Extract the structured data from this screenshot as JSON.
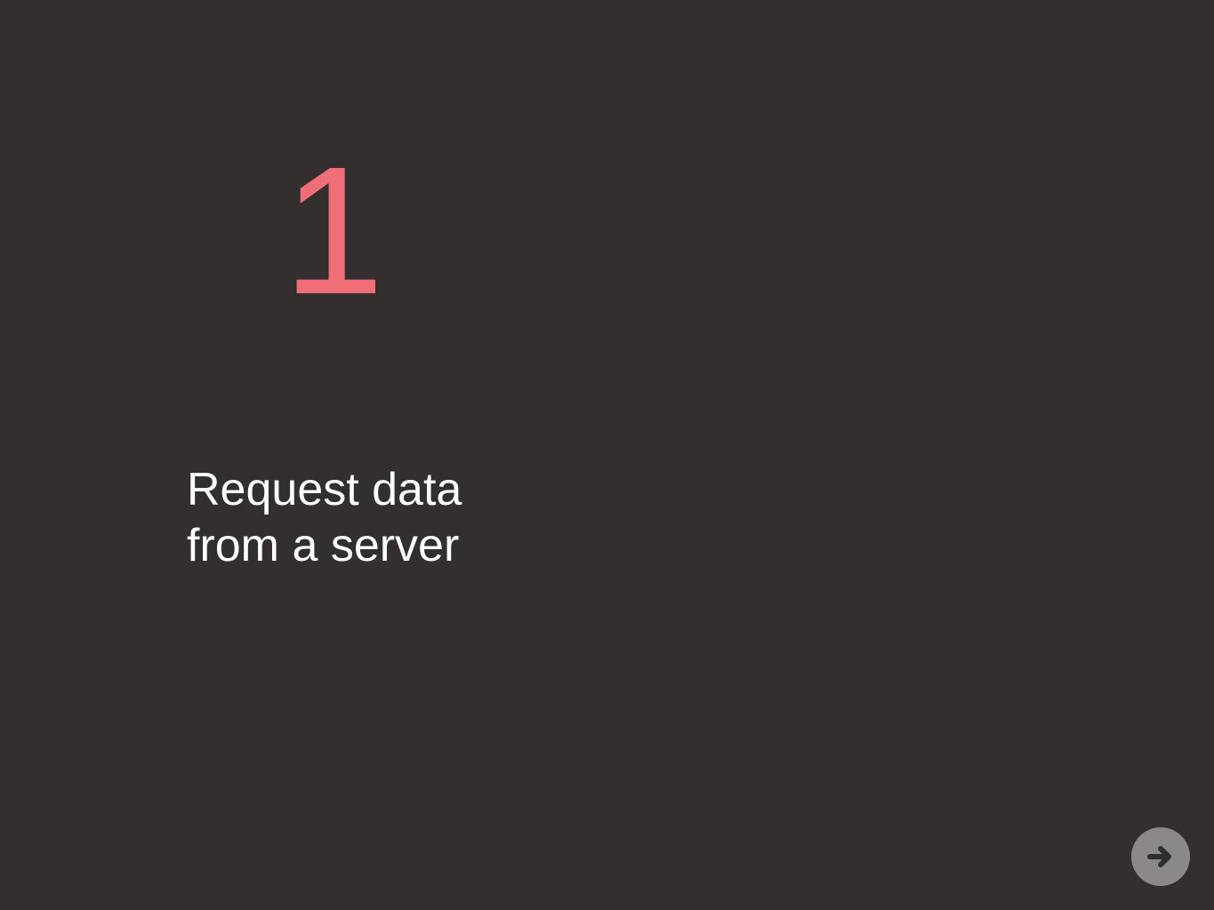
{
  "slide": {
    "step_number": "1",
    "text_lines": [
      "Request data",
      "from a server"
    ]
  },
  "controls": {
    "next_icon": "arrow-right-icon"
  },
  "colors": {
    "background": "#322f2e",
    "accent": "#f06e78",
    "text": "#ffffff",
    "button": "#8b8988",
    "button_icon": "#2f2d2c"
  }
}
